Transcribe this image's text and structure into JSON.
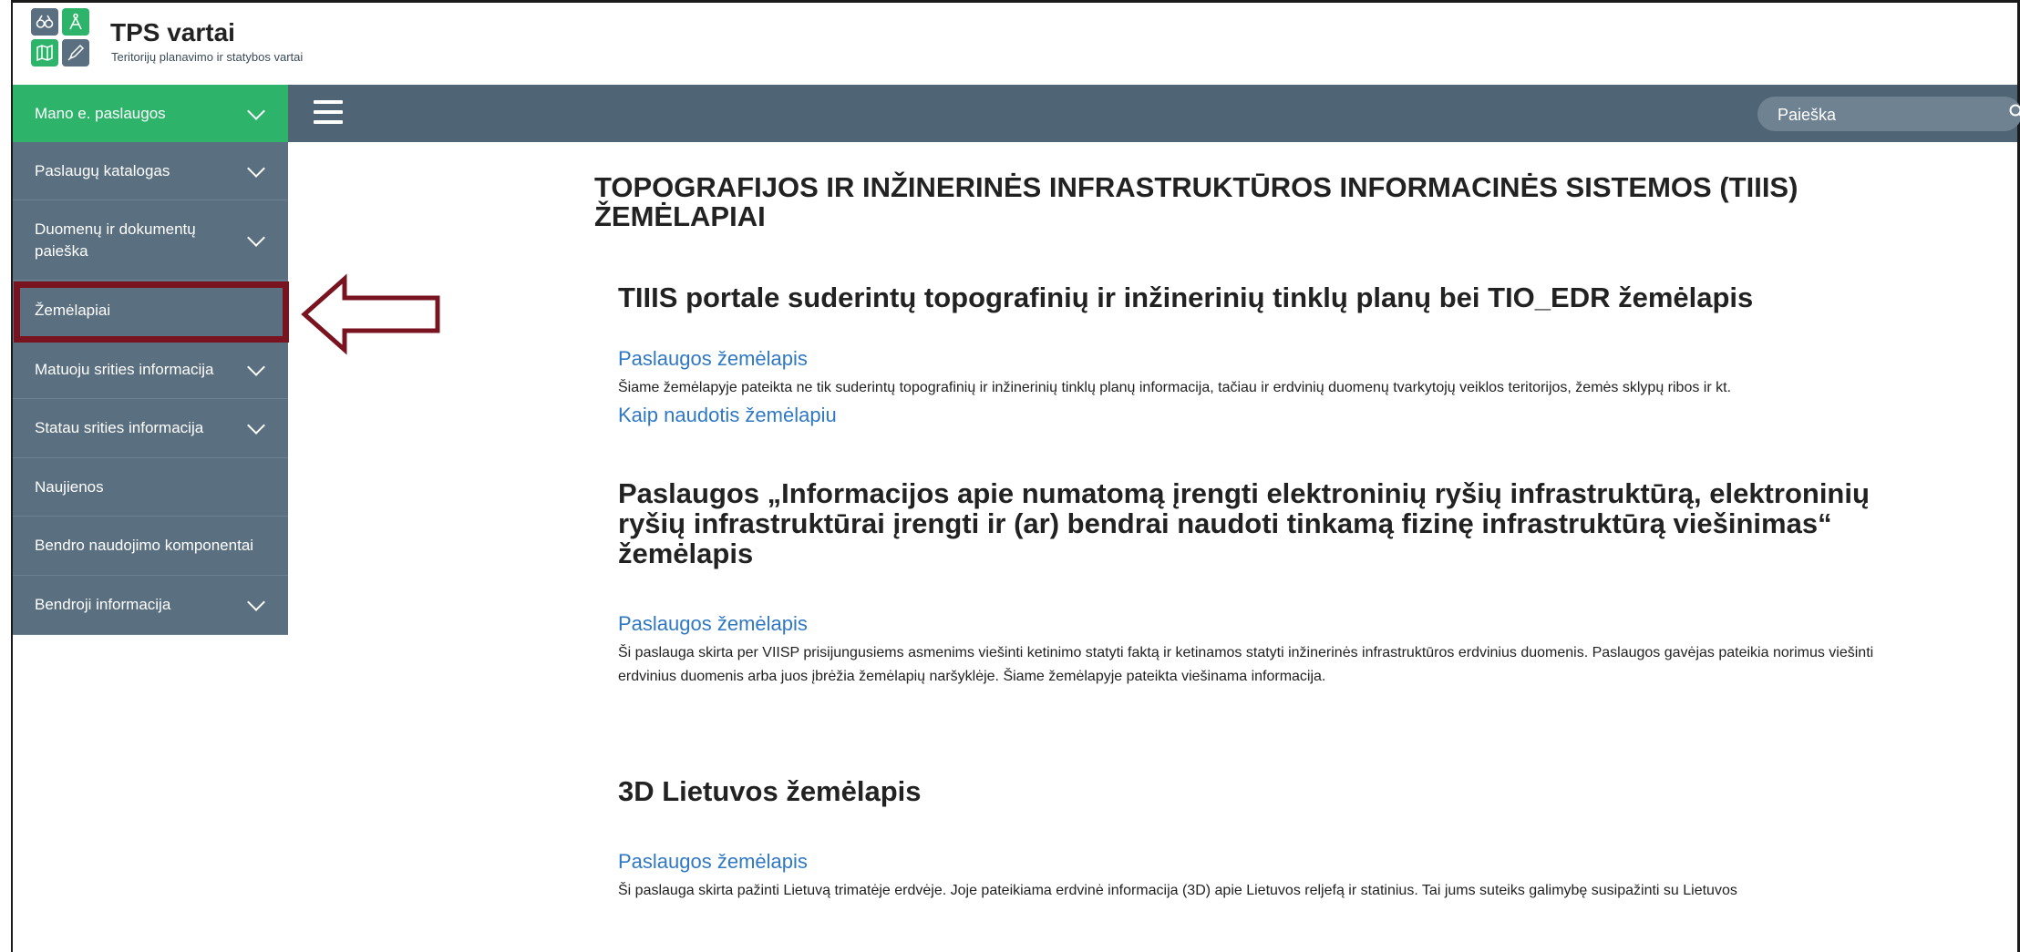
{
  "brand": {
    "title": "TPS vartai",
    "subtitle": "Teritorijų planavimo ir statybos vartai"
  },
  "topbar": {
    "search_placeholder": "Paieška"
  },
  "sidebar": {
    "items": [
      {
        "label": "Mano e. paslaugos",
        "has_chevron": true,
        "active": true
      },
      {
        "label": "Paslaugų katalogas",
        "has_chevron": true
      },
      {
        "label": "Duomenų ir dokumentų paieška",
        "has_chevron": true
      },
      {
        "label": "Žemėlapiai",
        "has_chevron": false,
        "highlighted": true
      },
      {
        "label": "Matuoju srities informacija",
        "has_chevron": true
      },
      {
        "label": "Statau srities informacija",
        "has_chevron": true
      },
      {
        "label": "Naujienos",
        "has_chevron": false
      },
      {
        "label": "Bendro naudojimo komponentai",
        "has_chevron": false
      },
      {
        "label": "Bendroji informacija",
        "has_chevron": true
      }
    ]
  },
  "main": {
    "title": "TOPOGRAFIJOS IR INŽINERINĖS INFRASTRUKTŪROS INFORMACINĖS SISTEMOS (TIIIS) ŽEMĖLAPIAI",
    "sections": [
      {
        "title": "TIIIS portale suderintų topografinių ir inžinerinių tinklų planų bei TIO_EDR žemėlapis",
        "link": "Paslaugos žemėlapis",
        "description": "Šiame žemėlapyje pateikta ne tik suderintų topografinių ir inžinerinių tinklų planų informacija, tačiau ir erdvinių duomenų tvarkytojų veiklos teritorijos, žemės sklypų ribos ir kt.",
        "link2": "Kaip naudotis žemėlapiu"
      },
      {
        "title": "Paslaugos „Informacijos apie numatomą įrengti elektroninių ryšių infrastruktūrą, elektroninių ryšių infrastruktūrai įrengti ir (ar) bendrai naudoti tinkamą fizinę infrastruktūrą viešinimas“ žemėlapis",
        "link": "Paslaugos žemėlapis",
        "description": "Ši paslauga skirta per VIISP prisijungusiems asmenims viešinti ketinimo statyti faktą ir ketinamos statyti inžinerinės infrastruktūros erdvinius duomenis. Paslaugos gavėjas pateikia norimus viešinti erdvinius duomenis arba juos įbrėžia žemėlapių naršyklėje. Šiame žemėlapyje pateikta viešinama informacija."
      },
      {
        "title": "3D Lietuvos žemėlapis",
        "link": "Paslaugos žemėlapis",
        "description": "Ši paslauga skirta pažinti Lietuvą trimatėje erdvėje. Joje pateikiama erdvinė informacija (3D) apie Lietuvos reljefą ir statinius. Tai jums suteiks galimybę susipažinti su Lietuvos"
      }
    ]
  },
  "colors": {
    "accent": "#2db36a",
    "nav_bg": "#5a6f80",
    "topbar_bg": "#4f6475",
    "link": "#2f78c4",
    "highlight": "#7a1320"
  },
  "icons": [
    "binoculars-icon",
    "compass-icon",
    "map-icon",
    "pen-icon",
    "menu-icon",
    "search-icon",
    "chevron-down-icon",
    "arrow-left-icon"
  ]
}
